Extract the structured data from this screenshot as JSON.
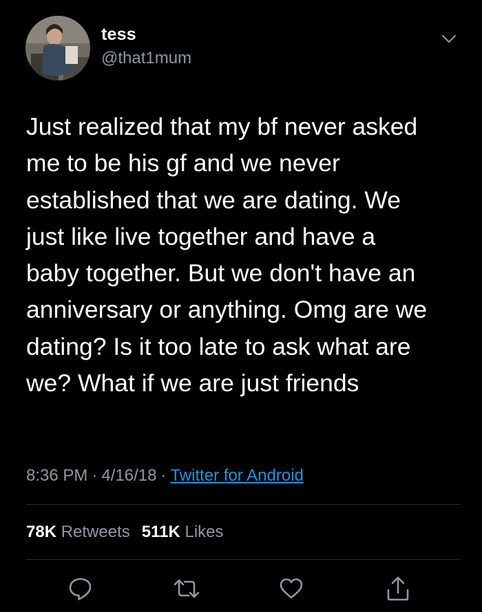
{
  "tweet": {
    "display_name": "tess",
    "handle": "@that1mum",
    "text": "Just realized that my bf never asked\nme to be his gf and we never\nestablished that we are dating. We\njust like live together and have a\nbaby together. But we don't have an\nanniversary or anything. Omg are we\ndating? Is it too late to ask what are\nwe? What if we are just friends",
    "time": "8:36 PM",
    "date": "4/16/18",
    "separator": "·",
    "source": "Twitter for Android",
    "retweets_count": "78K",
    "retweets_label": "Retweets",
    "likes_count": "511K",
    "likes_label": "Likes"
  },
  "icons": {
    "menu": "chevron-down-icon",
    "reply": "reply-icon",
    "retweet": "retweet-icon",
    "like": "like-icon",
    "share": "share-icon"
  },
  "colors": {
    "background": "#000000",
    "text": "#ffffff",
    "secondary": "#8e98a3",
    "link": "#1b95e0",
    "divider": "#2b2e33"
  }
}
